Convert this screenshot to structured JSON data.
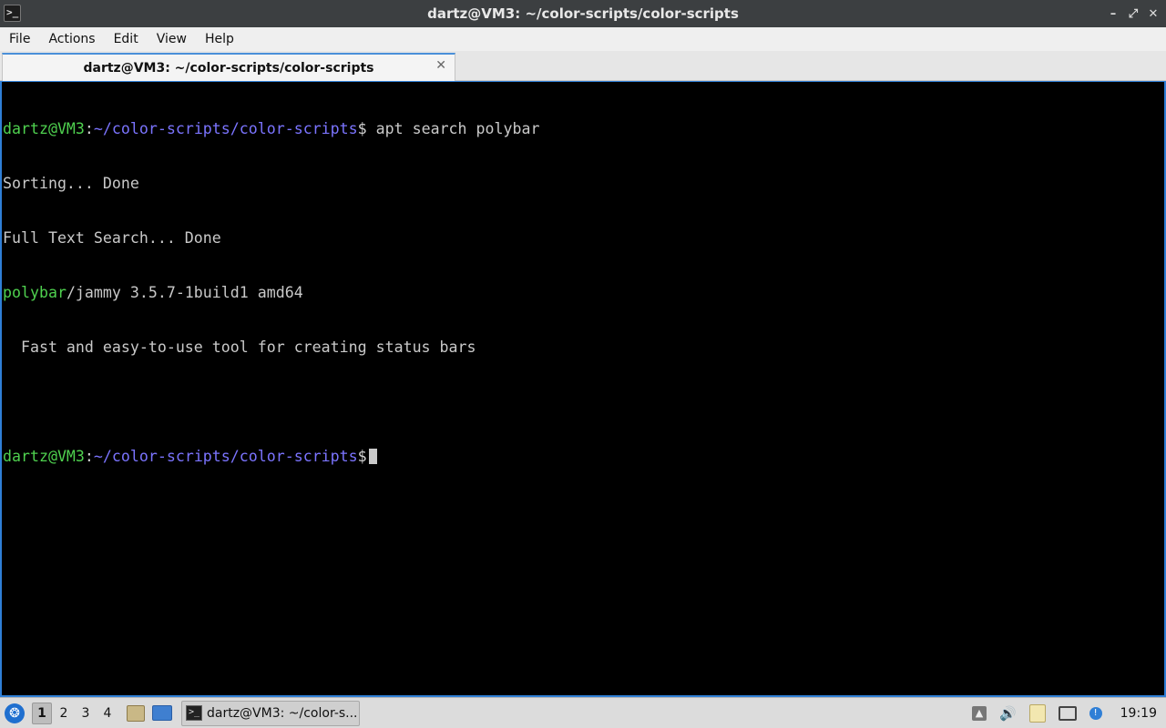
{
  "window": {
    "title": "dartz@VM3: ~/color-scripts/color-scripts",
    "app_icon_glyph": ">_",
    "controls": {
      "minimize": "–",
      "maximize": "⤢",
      "close": "✕"
    }
  },
  "menubar": {
    "items": [
      "File",
      "Actions",
      "Edit",
      "View",
      "Help"
    ]
  },
  "tabs": [
    {
      "label": "dartz@VM3: ~/color-scripts/color-scripts",
      "close": "✕",
      "active": true
    }
  ],
  "terminal": {
    "user_host": "dartz@VM3",
    "colon": ":",
    "path": "~/color-scripts/color-scripts",
    "prompt_symbol": "$",
    "command": " apt search polybar",
    "output": [
      "Sorting... Done",
      "Full Text Search... Done"
    ],
    "package_name": "polybar",
    "package_rest": "/jammy 3.5.7-1build1 amd64",
    "package_description": "  Fast and easy-to-use tool for creating status bars",
    "colors": {
      "user_host": "#4fd14f",
      "path": "#7b74ff",
      "text": "#c9c9c9",
      "border": "#2f7fd6"
    }
  },
  "taskbar": {
    "start_glyph": "❂",
    "workspaces": [
      "1",
      "2",
      "3",
      "4"
    ],
    "active_workspace": "1",
    "task_label": "dartz@VM3: ~/color-s...",
    "task_icon_glyph": ">_",
    "tray_volume_glyph": "🔊",
    "clock": "19:19"
  }
}
